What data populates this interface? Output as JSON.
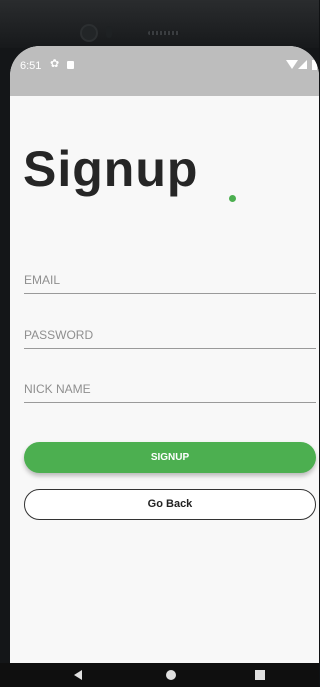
{
  "status_bar": {
    "time": "6:51",
    "icons": [
      "gear-icon",
      "sd-card-icon",
      "wifi-icon",
      "signal-icon",
      "battery-icon"
    ]
  },
  "page": {
    "title": "Signup",
    "accent_color": "#4caf50"
  },
  "form": {
    "email_placeholder": "EMAIL",
    "email_value": "",
    "password_placeholder": "PASSWORD",
    "password_value": "",
    "nickname_placeholder": "NICK NAME",
    "nickname_value": ""
  },
  "buttons": {
    "signup_label": "SIGNUP",
    "go_back_label": "Go Back"
  },
  "nav_bar": {
    "icons": [
      "back-icon",
      "home-icon",
      "recents-icon"
    ]
  }
}
